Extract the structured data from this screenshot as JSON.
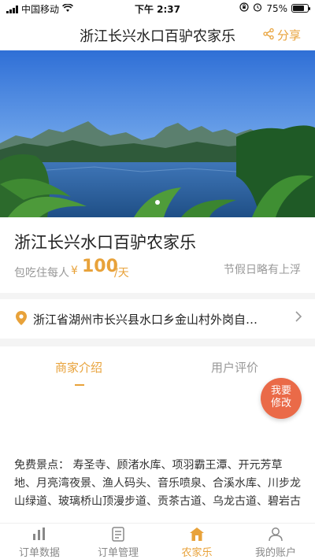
{
  "status_bar": {
    "carrier": "中国移动",
    "time": "下午 2:37",
    "battery": "75%",
    "battery_level": 0.75,
    "icons": [
      "signal-icon",
      "wifi-icon",
      "rotation-lock-icon",
      "alarm-icon",
      "battery-icon"
    ]
  },
  "nav": {
    "title": "浙江长兴水口百驴农家乐",
    "share_label": "分享",
    "share_icon": "share-icon"
  },
  "hero": {
    "carousel_dots": 1,
    "active_dot": 0
  },
  "listing": {
    "name": "浙江长兴水口百驴农家乐",
    "price_label": "包吃住每人",
    "price_symbol": "¥",
    "price_value": "100",
    "price_unit": "/天",
    "holiday_note": "节假日略有上浮"
  },
  "address": {
    "text": "浙江省湖州市长兴县水口乡金山村外岗自…",
    "icon": "location-pin-icon"
  },
  "tabs": [
    {
      "label": "商家介绍",
      "active": true
    },
    {
      "label": "用户评价",
      "active": false
    }
  ],
  "review_button": {
    "line1": "我要",
    "line2": "修改"
  },
  "description": "免费景点：  寿圣寺、顾渚水库、项羽霸王潭、开元芳草地、月亮湾夜景、渔人码头、音乐喷泉、合溪水库、川步龙山绿道、玻璃桥山顶漫步道、贡茶古道、乌龙古道、碧岩古道等十大古道",
  "tabbar": [
    {
      "label": "订单数据",
      "icon": "chart-icon",
      "active": false
    },
    {
      "label": "订单管理",
      "icon": "document-icon",
      "active": false
    },
    {
      "label": "农家乐",
      "icon": "home-icon",
      "active": true
    },
    {
      "label": "我的账户",
      "icon": "user-icon",
      "active": false
    }
  ],
  "colors": {
    "accent": "#e8a23a",
    "review_button": "#ea6a48",
    "muted_text": "#999999",
    "divider": "#f4f4f4"
  }
}
